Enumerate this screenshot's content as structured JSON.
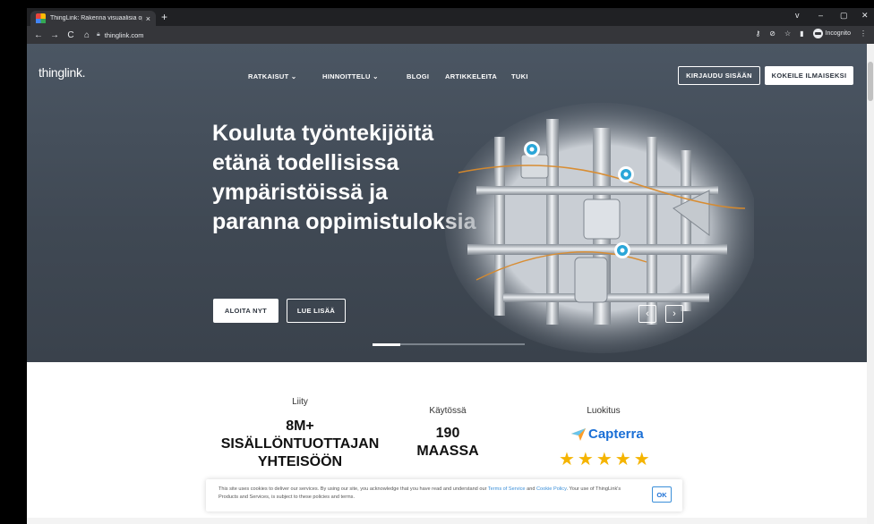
{
  "browser": {
    "tab_title": "ThingLink: Rakenna visuaalisia op",
    "tab_close": "×",
    "new_tab": "+",
    "url": "thinglink.com",
    "incognito_label": "Incognito",
    "window_controls": [
      "v",
      "–",
      "▢",
      "✕"
    ]
  },
  "site": {
    "logo": "thinglink.",
    "nav": [
      {
        "label": "RATKAISUT ⌄"
      },
      {
        "label": "HINNOITTELU ⌄"
      },
      {
        "label": "BLOGI"
      },
      {
        "label": "ARTIKKELEITA"
      },
      {
        "label": "TUKI"
      }
    ],
    "login_button": "KIRJAUDU SISÄÄN",
    "trial_button": "KOKEILE ILMAISEKSI"
  },
  "hero": {
    "headline": "Kouluta työntekijöitä etänä todellisissa ympäristöissä ja paranna oppimistuloksia",
    "start_button": "ALOITA NYT",
    "read_more_button": "LUE LISÄÄ",
    "prev": "‹",
    "next": "›",
    "slide_progress": 0.18
  },
  "stats": {
    "join_label": "Liity",
    "join_value_line1": "8M+",
    "join_value_line2": "SISÄLLÖNTUOTTAJAN",
    "join_value_line3": "YHTEISÖÖN",
    "use_label": "Käytössä",
    "use_value_line1": "190",
    "use_value_line2": "MAASSA",
    "rating_label": "Luokitus",
    "capterra_name": "Capterra",
    "stars": "★★★★★"
  },
  "cookie": {
    "text_a": "This site uses cookies to deliver our services. By using our site, you acknowledge that you have read and understand our ",
    "link_terms": "Terms of Service",
    "text_b": " and ",
    "link_cookie": "Cookie Policy",
    "text_c": ". Your use of ThingLink's Products and Services, is subject to these policies and terms.",
    "ok": "OK"
  }
}
